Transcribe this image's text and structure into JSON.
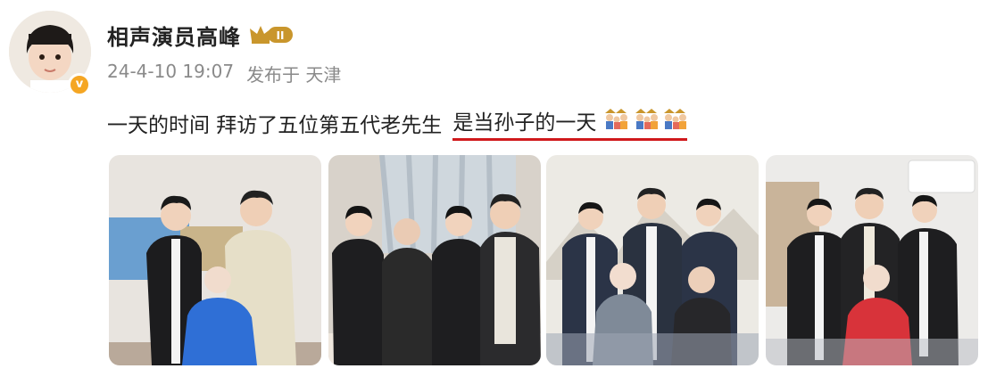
{
  "user": {
    "name": "相声演员高峰",
    "vip_level": "II",
    "verified_mark": "v"
  },
  "meta": {
    "timestamp": "24-4-10 19:07",
    "source": "发布于 天津"
  },
  "post": {
    "text_part1": "一天的时间 拜访了五位第五代老先生",
    "text_part2": "是当孙子的一天",
    "emoji_icon": "family-emoji"
  },
  "colors": {
    "underline": "#d0191c",
    "vip_gold": "#c9962c",
    "verified_orange": "#f5a623"
  }
}
